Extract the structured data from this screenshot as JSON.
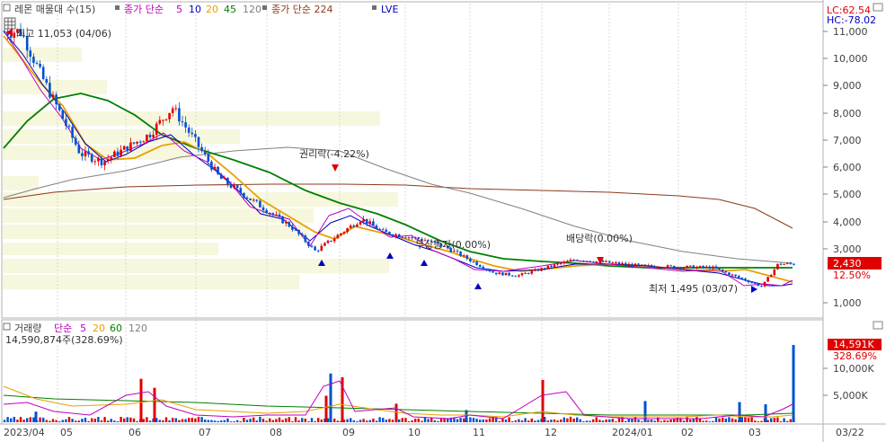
{
  "price_panel": {
    "legend": {
      "title": "레몬 매물대 수(15)",
      "ma_prefix": "종가 단순",
      "ma_periods": [
        "5",
        "10",
        "20",
        "45",
        "120"
      ],
      "ma_colors": [
        "#c000c0",
        "#0000c0",
        "#e8a000",
        "#008000",
        "#808080"
      ],
      "ma224": "종가 단순 224",
      "lve": "LVE"
    },
    "annotations": {
      "high": "최고 11,053 (04/06)",
      "low": "최저 1,495 (03/07)",
      "rights": "권리락(-4.22%)",
      "capital_increase": "무상증자(0.00%)",
      "dividend": "배당락(0.00%)"
    },
    "right_scale": {
      "lc": "LC:62.54",
      "hc": "HC:-78.02",
      "ticks": [
        "11,000",
        "10,000",
        "9,000",
        "8,000",
        "7,000",
        "6,000",
        "5,000",
        "4,000",
        "3,000",
        "1,000"
      ],
      "last_price": "2,430",
      "last_pct": "12.50%"
    }
  },
  "volume_panel": {
    "legend": {
      "title": "거래량",
      "ma_prefix": "단순",
      "ma_periods": [
        "5",
        "20",
        "60",
        "120"
      ],
      "ma_colors": [
        "#c000c0",
        "#e8a000",
        "#008000",
        "#808080"
      ]
    },
    "value_line": "14,590,874주(328.69%)",
    "right_scale": {
      "ticks": [
        "10,000K",
        "5,000K"
      ],
      "last_volume": "14,591K",
      "last_pct": "328.69%"
    }
  },
  "x_axis": {
    "labels": [
      "2023/04",
      "05",
      "06",
      "07",
      "08",
      "09",
      "10",
      "11",
      "12",
      "2024/01",
      "02",
      "03"
    ],
    "right_date": "03/22"
  },
  "chart_data": {
    "type": "candlestick",
    "price_axis": {
      "ylim": [
        500,
        11500
      ],
      "ticks": [
        1000,
        3000,
        4000,
        5000,
        6000,
        7000,
        8000,
        9000,
        10000,
        11000
      ]
    },
    "x_categories": [
      "2023/04",
      "05",
      "06",
      "07",
      "08",
      "09",
      "10",
      "11",
      "12",
      "2024/01",
      "02",
      "03"
    ],
    "price_series_approx": [
      {
        "x": "2023/04",
        "close": 11000
      },
      {
        "x": "2023/04",
        "close": 9500
      },
      {
        "x": "05",
        "close": 6500
      },
      {
        "x": "05",
        "close": 6200
      },
      {
        "x": "06",
        "close": 7200
      },
      {
        "x": "06",
        "close": 8200
      },
      {
        "x": "07",
        "close": 5600
      },
      {
        "x": "07",
        "close": 5000
      },
      {
        "x": "08",
        "close": 3800
      },
      {
        "x": "08",
        "close": 2900
      },
      {
        "x": "09",
        "close": 4100
      },
      {
        "x": "09",
        "close": 3600
      },
      {
        "x": "10",
        "close": 3300
      },
      {
        "x": "10",
        "close": 3000
      },
      {
        "x": "11",
        "close": 2100
      },
      {
        "x": "11",
        "close": 2000
      },
      {
        "x": "12",
        "close": 2600
      },
      {
        "x": "2024/01",
        "close": 2350
      },
      {
        "x": "02",
        "close": 2300
      },
      {
        "x": "03",
        "close": 1600
      },
      {
        "x": "03",
        "close": 2430
      }
    ],
    "moving_averages": [
      {
        "name": "5",
        "color": "#c000c0"
      },
      {
        "name": "10",
        "color": "#0000c0"
      },
      {
        "name": "20",
        "color": "#e8a000"
      },
      {
        "name": "45",
        "color": "#008000"
      },
      {
        "name": "120",
        "color": "#808080"
      },
      {
        "name": "224",
        "color": "#8b3a1a"
      }
    ],
    "volume_axis": {
      "ylim": [
        0,
        16000000
      ],
      "ticks": [
        5000000,
        10000000
      ]
    },
    "volume_highlights_approx": [
      {
        "x": "2023/04",
        "volume": 2000000
      },
      {
        "x": "06",
        "volume": 8200000
      },
      {
        "x": "06",
        "volume": 6500000
      },
      {
        "x": "08",
        "volume": 5000000
      },
      {
        "x": "08",
        "volume": 9200000
      },
      {
        "x": "09",
        "volume": 8500000
      },
      {
        "x": "10",
        "volume": 3500000
      },
      {
        "x": "11",
        "volume": 2300000
      },
      {
        "x": "12",
        "volume": 8000000
      },
      {
        "x": "2024/01",
        "volume": 4000000
      },
      {
        "x": "02",
        "volume": 3800000
      },
      {
        "x": "03",
        "volume": 3400000
      },
      {
        "x": "03",
        "volume": 14590874
      }
    ],
    "volume_profile_rows_approx": 15
  }
}
